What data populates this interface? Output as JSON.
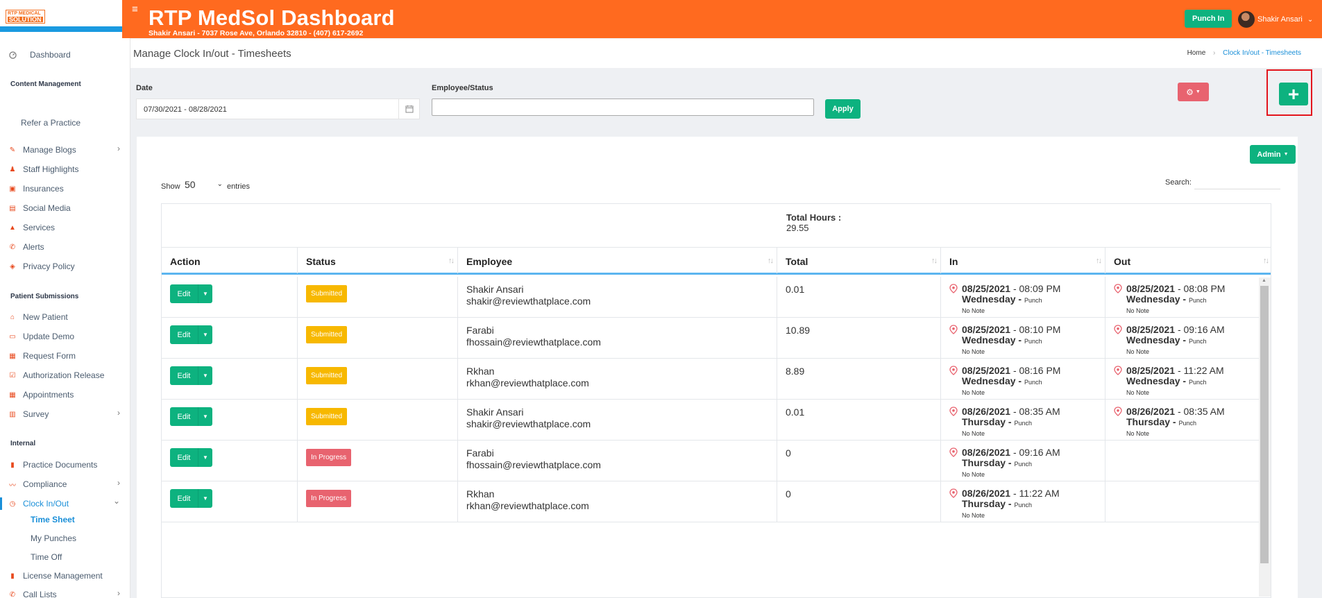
{
  "brand": {
    "logo_line1": "RTP MEDICAL",
    "logo_line2": "SOLUTION"
  },
  "header": {
    "title": "RTP MedSol Dashboard",
    "subtitle": "Shakir Ansari - 7037 Rose Ave, Orlando 32810 - (407) 617-2692",
    "punch_in": "Punch In",
    "user_name": "Shakir Ansari"
  },
  "sidebar": {
    "dashboard": "Dashboard",
    "content_head": "Content Management",
    "refer": "Refer a Practice",
    "manage_blogs": "Manage Blogs",
    "staff_highlights": "Staff Highlights",
    "insurances": "Insurances",
    "social_media": "Social Media",
    "services": "Services",
    "alerts": "Alerts",
    "privacy_policy": "Privacy Policy",
    "patient_head": "Patient Submissions",
    "new_patient": "New Patient",
    "update_demo": "Update Demo",
    "request_form": "Request Form",
    "authorization_release": "Authorization Release",
    "appointments": "Appointments",
    "survey": "Survey",
    "internal_head": "Internal",
    "practice_documents": "Practice Documents",
    "compliance": "Compliance",
    "clock_inout": "Clock In/Out",
    "time_sheet": "Time Sheet",
    "my_punches": "My Punches",
    "time_off": "Time Off",
    "license_management": "License Management",
    "call_lists": "Call Lists"
  },
  "page": {
    "title": "Manage Clock In/out - Timesheets",
    "crumb_home": "Home",
    "crumb_current": "Clock In/out - Timesheets"
  },
  "filters": {
    "date_label": "Date",
    "date_value": "07/30/2021 - 08/28/2021",
    "employee_label": "Employee/Status",
    "employee_value": "",
    "apply": "Apply",
    "add": "+"
  },
  "card": {
    "admin": "Admin",
    "show": "Show",
    "page_size": "50",
    "entries": "entries",
    "search_label": "Search:",
    "total_hours_label": "Total Hours :",
    "total_hours_value": "29.55"
  },
  "table": {
    "columns": [
      "Action",
      "Status",
      "Employee",
      "Total",
      "In",
      "Out"
    ],
    "edit_label": "Edit",
    "rows": [
      {
        "status": "Submitted",
        "emp_name": "Shakir Ansari",
        "emp_email": "shakir@reviewthatplace.com",
        "total": "0.01",
        "in_date": "08/25/2021",
        "in_time": " - 08:09 PM",
        "in_day": "Wednesday",
        "in_type": "Punch",
        "in_note": "No Note",
        "out_date": "08/25/2021",
        "out_time": " - 08:08 PM",
        "out_day": "Wednesday",
        "out_type": "Punch",
        "out_note": "No Note"
      },
      {
        "status": "Submitted",
        "emp_name": "Farabi",
        "emp_email": "fhossain@reviewthatplace.com",
        "total": "10.89",
        "in_date": "08/25/2021",
        "in_time": " - 08:10 PM",
        "in_day": "Wednesday",
        "in_type": "Punch",
        "in_note": "No Note",
        "out_date": "08/25/2021",
        "out_time": " - 09:16 AM",
        "out_day": "Wednesday",
        "out_type": "Punch",
        "out_note": "No Note"
      },
      {
        "status": "Submitted",
        "emp_name": "Rkhan",
        "emp_email": "rkhan@reviewthatplace.com",
        "total": "8.89",
        "in_date": "08/25/2021",
        "in_time": " - 08:16 PM",
        "in_day": "Wednesday",
        "in_type": "Punch",
        "in_note": "No Note",
        "out_date": "08/25/2021",
        "out_time": " - 11:22 AM",
        "out_day": "Wednesday",
        "out_type": "Punch",
        "out_note": "No Note"
      },
      {
        "status": "Submitted",
        "emp_name": "Shakir Ansari",
        "emp_email": "shakir@reviewthatplace.com",
        "total": "0.01",
        "in_date": "08/26/2021",
        "in_time": " - 08:35 AM",
        "in_day": "Thursday",
        "in_type": "Punch",
        "in_note": "No Note",
        "out_date": "08/26/2021",
        "out_time": " - 08:35 AM",
        "out_day": "Thursday",
        "out_type": "Punch",
        "out_note": "No Note"
      },
      {
        "status": "In Progress",
        "emp_name": "Farabi",
        "emp_email": "fhossain@reviewthatplace.com",
        "total": "0",
        "in_date": "08/26/2021",
        "in_time": " - 09:16 AM",
        "in_day": "Thursday",
        "in_type": "Punch",
        "in_note": "No Note",
        "out_date": "",
        "out_time": "",
        "out_day": "",
        "out_type": "",
        "out_note": ""
      },
      {
        "status": "In Progress",
        "emp_name": "Rkhan",
        "emp_email": "rkhan@reviewthatplace.com",
        "total": "0",
        "in_date": "08/26/2021",
        "in_time": " - 11:22 AM",
        "in_day": "Thursday",
        "in_type": "Punch",
        "in_note": "No Note",
        "out_date": "",
        "out_time": "",
        "out_day": "",
        "out_type": "",
        "out_note": ""
      }
    ]
  },
  "colors": {
    "header": "#ff6a1f",
    "primary": "#0db27f",
    "submitted": "#f7b800",
    "in_progress": "#e8636f",
    "link": "#1a8fd8"
  }
}
